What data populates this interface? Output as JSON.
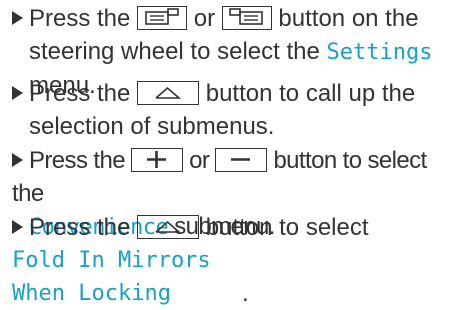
{
  "steps": [
    {
      "pre": "Press the",
      "or": "or",
      "mid": "button on the",
      "line2": "steering wheel to select the",
      "kw": "Settings",
      "line3": "menu."
    },
    {
      "pre": "Press the",
      "mid": "button to call up the",
      "line2": "selection of submenus."
    },
    {
      "pre": "Press the",
      "or": "or",
      "mid": "button to select the",
      "kw": "Convenience",
      "post": "submenu."
    },
    {
      "pre": "Press the",
      "mid": "button to select",
      "kw": "Fold In Mirrors When Locking",
      "post": "."
    }
  ],
  "icons": {
    "page_back": "page-back-icon",
    "page_forward": "page-forward-icon",
    "home": "home-icon",
    "plus": "plus-icon",
    "minus": "minus-icon"
  },
  "colors": {
    "keyword": "#1aa0c8",
    "text": "#333333"
  }
}
